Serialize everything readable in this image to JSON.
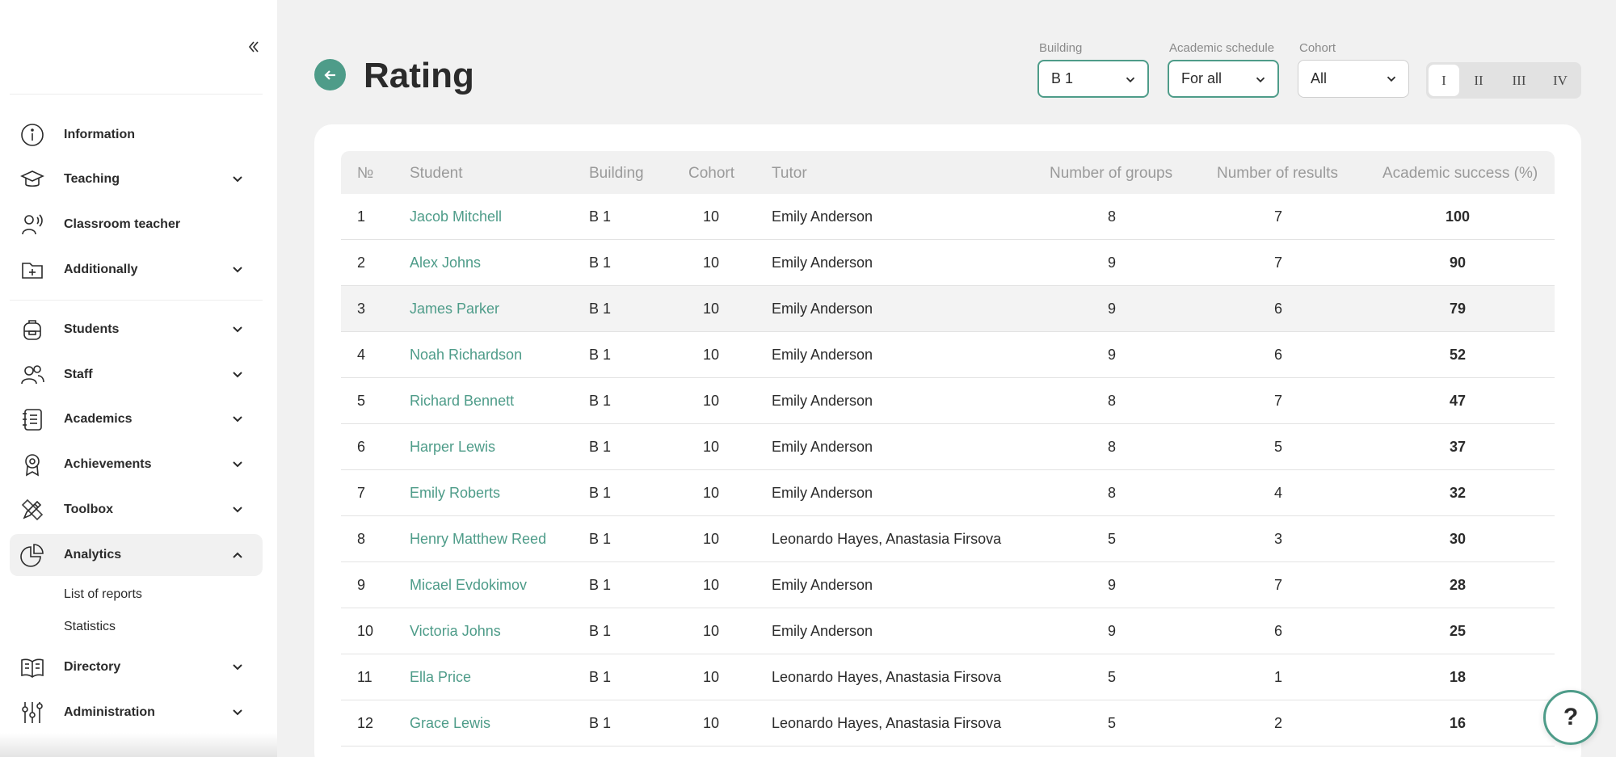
{
  "sidebar": {
    "items": [
      {
        "label": "Information",
        "icon": "info-icon",
        "expandable": false
      },
      {
        "label": "Teaching",
        "icon": "graduation-cap-icon",
        "expandable": true
      },
      {
        "label": "Classroom teacher",
        "icon": "speaking-person-icon",
        "expandable": false
      },
      {
        "label": "Additionally",
        "icon": "folder-plus-icon",
        "expandable": true
      },
      {
        "label": "Students",
        "icon": "backpack-icon",
        "expandable": true
      },
      {
        "label": "Staff",
        "icon": "users-icon",
        "expandable": true
      },
      {
        "label": "Academics",
        "icon": "notebook-icon",
        "expandable": true
      },
      {
        "label": "Achievements",
        "icon": "award-icon",
        "expandable": true
      },
      {
        "label": "Toolbox",
        "icon": "pencil-ruler-icon",
        "expandable": true
      },
      {
        "label": "Analytics",
        "icon": "pie-chart-icon",
        "expandable": true,
        "active": true
      },
      {
        "label": "Directory",
        "icon": "open-book-icon",
        "expandable": true
      },
      {
        "label": "Administration",
        "icon": "sliders-icon",
        "expandable": true
      }
    ],
    "analytics_sub": [
      "List of reports",
      "Statistics"
    ]
  },
  "header": {
    "title": "Rating"
  },
  "filters": {
    "building": {
      "label": "Building",
      "value": "B 1"
    },
    "schedule": {
      "label": "Academic schedule",
      "value": "For all"
    },
    "cohort": {
      "label": "Cohort",
      "value": "All"
    },
    "quarters": [
      "I",
      "II",
      "III",
      "IV"
    ],
    "active_quarter": "I"
  },
  "table": {
    "headers": {
      "num": "№",
      "student": "Student",
      "building": "Building",
      "cohort": "Cohort",
      "tutor": "Tutor",
      "groups": "Number of groups",
      "results": "Number of results",
      "success": "Academic success (%)"
    },
    "rows": [
      {
        "num": "1",
        "student": "Jacob Mitchell",
        "building": "B 1",
        "cohort": "10",
        "tutor": "Emily Anderson",
        "groups": "8",
        "results": "7",
        "success": "100"
      },
      {
        "num": "2",
        "student": "Alex Johns",
        "building": "B 1",
        "cohort": "10",
        "tutor": "Emily Anderson",
        "groups": "9",
        "results": "7",
        "success": "90"
      },
      {
        "num": "3",
        "student": "James Parker",
        "building": "B 1",
        "cohort": "10",
        "tutor": "Emily Anderson",
        "groups": "9",
        "results": "6",
        "success": "79"
      },
      {
        "num": "4",
        "student": "Noah Richardson",
        "building": "B 1",
        "cohort": "10",
        "tutor": "Emily Anderson",
        "groups": "9",
        "results": "6",
        "success": "52"
      },
      {
        "num": "5",
        "student": "Richard Bennett",
        "building": "B 1",
        "cohort": "10",
        "tutor": "Emily Anderson",
        "groups": "8",
        "results": "7",
        "success": "47"
      },
      {
        "num": "6",
        "student": "Harper Lewis",
        "building": "B 1",
        "cohort": "10",
        "tutor": "Emily Anderson",
        "groups": "8",
        "results": "5",
        "success": "37"
      },
      {
        "num": "7",
        "student": "Emily Roberts",
        "building": "B 1",
        "cohort": "10",
        "tutor": "Emily Anderson",
        "groups": "8",
        "results": "4",
        "success": "32"
      },
      {
        "num": "8",
        "student": "Henry Matthew Reed",
        "building": "B 1",
        "cohort": "10",
        "tutor": "Leonardo Hayes, Anastasia Firsova",
        "groups": "5",
        "results": "3",
        "success": "30"
      },
      {
        "num": "9",
        "student": "Micael Evdokimov",
        "building": "B 1",
        "cohort": "10",
        "tutor": "Emily Anderson",
        "groups": "9",
        "results": "7",
        "success": "28"
      },
      {
        "num": "10",
        "student": "Victoria Johns",
        "building": "B 1",
        "cohort": "10",
        "tutor": "Emily Anderson",
        "groups": "9",
        "results": "6",
        "success": "25"
      },
      {
        "num": "11",
        "student": "Ella Price",
        "building": "B 1",
        "cohort": "10",
        "tutor": "Leonardo Hayes, Anastasia Firsova",
        "groups": "5",
        "results": "1",
        "success": "18"
      },
      {
        "num": "12",
        "student": "Grace Lewis",
        "building": "B 1",
        "cohort": "10",
        "tutor": "Leonardo Hayes, Anastasia Firsova",
        "groups": "5",
        "results": "2",
        "success": "16"
      }
    ]
  },
  "help": {
    "label": "?"
  },
  "colors": {
    "accent": "#4e9c89",
    "background": "#f1f1f1",
    "text": "#2b2b2b",
    "muted": "#9a9a9a"
  }
}
